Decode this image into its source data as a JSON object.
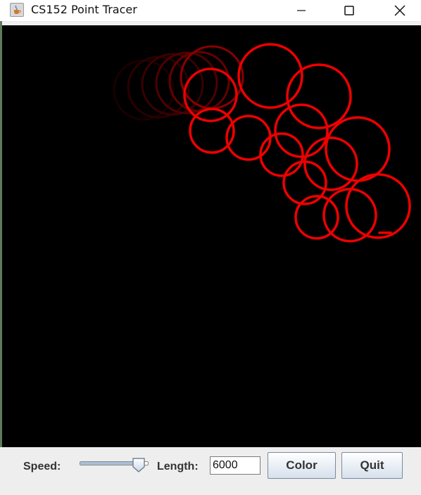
{
  "window": {
    "title": "CS152 Point Tracer",
    "icon": "java-cup-icon"
  },
  "controls": {
    "speed_label": "Speed:",
    "speed_value": 0.9,
    "length_label": "Length:",
    "length_value": "6000",
    "color_button": "Color",
    "quit_button": "Quit"
  },
  "colors": {
    "trace": "#ff0000",
    "background": "#000000"
  }
}
